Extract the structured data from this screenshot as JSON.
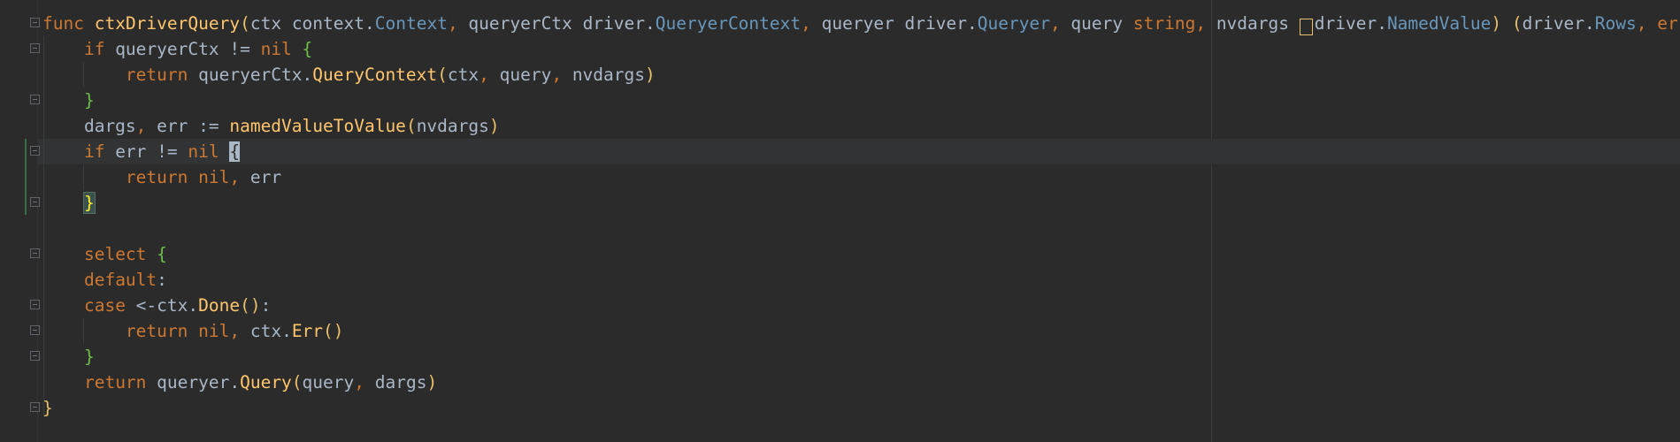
{
  "editor": {
    "theme_colors": {
      "background": "#2b2b2b",
      "keyword": "#cc7832",
      "function": "#ffc66d",
      "type": "#6897bb",
      "identifier": "#a9b7c6"
    },
    "lines": [
      {
        "tokens": [
          {
            "t": "func",
            "c": "kw"
          },
          {
            "t": " ",
            "c": "id"
          },
          {
            "t": "ctxDriverQuery",
            "c": "fn"
          },
          {
            "t": "(",
            "c": "br"
          },
          {
            "t": "ctx ",
            "c": "id"
          },
          {
            "t": "context",
            "c": "pkg"
          },
          {
            "t": ".",
            "c": "id"
          },
          {
            "t": "Context",
            "c": "typ"
          },
          {
            "t": ", ",
            "c": "pun"
          },
          {
            "t": "queryerCtx ",
            "c": "id"
          },
          {
            "t": "driver",
            "c": "pkg"
          },
          {
            "t": ".",
            "c": "id"
          },
          {
            "t": "QueryerContext",
            "c": "typ"
          },
          {
            "t": ", ",
            "c": "pun"
          },
          {
            "t": "queryer ",
            "c": "id"
          },
          {
            "t": "driver",
            "c": "pkg"
          },
          {
            "t": ".",
            "c": "id"
          },
          {
            "t": "Queryer",
            "c": "typ"
          },
          {
            "t": ", ",
            "c": "pun"
          },
          {
            "t": "query ",
            "c": "id"
          },
          {
            "t": "string",
            "c": "kw"
          },
          {
            "t": ", ",
            "c": "pun"
          },
          {
            "t": "nvdargs ",
            "c": "id"
          },
          {
            "t": "[]",
            "c": "box"
          },
          {
            "t": "driver",
            "c": "pkg"
          },
          {
            "t": ".",
            "c": "id"
          },
          {
            "t": "NamedValue",
            "c": "typ"
          },
          {
            "t": ")",
            "c": "br"
          },
          {
            "t": " ",
            "c": "id"
          },
          {
            "t": "(",
            "c": "br"
          },
          {
            "t": "driver",
            "c": "pkg"
          },
          {
            "t": ".",
            "c": "id"
          },
          {
            "t": "Rows",
            "c": "typ"
          },
          {
            "t": ", ",
            "c": "pun"
          },
          {
            "t": "error",
            "c": "kw"
          },
          {
            "t": ")",
            "c": "br"
          },
          {
            "t": " ",
            "c": "id"
          },
          {
            "t": "{",
            "c": "br"
          }
        ]
      },
      {
        "tokens": [
          {
            "t": "    ",
            "c": "id"
          },
          {
            "t": "if",
            "c": "kw"
          },
          {
            "t": " queryerCtx != ",
            "c": "id"
          },
          {
            "t": "nil",
            "c": "kw"
          },
          {
            "t": " ",
            "c": "id"
          },
          {
            "t": "{",
            "c": "br2"
          }
        ]
      },
      {
        "tokens": [
          {
            "t": "        ",
            "c": "id"
          },
          {
            "t": "return",
            "c": "kw"
          },
          {
            "t": " queryerCtx.",
            "c": "id"
          },
          {
            "t": "QueryContext",
            "c": "fn"
          },
          {
            "t": "(",
            "c": "br"
          },
          {
            "t": "ctx",
            "c": "id"
          },
          {
            "t": ", ",
            "c": "pun"
          },
          {
            "t": "query",
            "c": "id"
          },
          {
            "t": ", ",
            "c": "pun"
          },
          {
            "t": "nvdargs",
            "c": "id"
          },
          {
            "t": ")",
            "c": "br"
          }
        ]
      },
      {
        "tokens": [
          {
            "t": "    ",
            "c": "id"
          },
          {
            "t": "}",
            "c": "br2"
          }
        ]
      },
      {
        "tokens": [
          {
            "t": "    dargs",
            "c": "id"
          },
          {
            "t": ", ",
            "c": "pun"
          },
          {
            "t": "err := ",
            "c": "id"
          },
          {
            "t": "namedValueToValue",
            "c": "fn"
          },
          {
            "t": "(",
            "c": "br"
          },
          {
            "t": "nvdargs",
            "c": "id"
          },
          {
            "t": ")",
            "c": "br"
          }
        ]
      },
      {
        "tokens": [
          {
            "t": "    ",
            "c": "id"
          },
          {
            "t": "if",
            "c": "kw"
          },
          {
            "t": " err != ",
            "c": "id"
          },
          {
            "t": "nil",
            "c": "kw"
          },
          {
            "t": " ",
            "c": "id"
          },
          {
            "t": "{",
            "c": "caret"
          }
        ]
      },
      {
        "tokens": [
          {
            "t": "        ",
            "c": "id"
          },
          {
            "t": "return",
            "c": "kw"
          },
          {
            "t": " ",
            "c": "id"
          },
          {
            "t": "nil",
            "c": "kw"
          },
          {
            "t": ", ",
            "c": "pun"
          },
          {
            "t": "err",
            "c": "id"
          }
        ]
      },
      {
        "tokens": [
          {
            "t": "    ",
            "c": "id"
          },
          {
            "t": "}",
            "c": "match"
          }
        ]
      },
      {
        "tokens": [
          {
            "t": "",
            "c": "id"
          }
        ]
      },
      {
        "tokens": [
          {
            "t": "    ",
            "c": "id"
          },
          {
            "t": "select",
            "c": "kw"
          },
          {
            "t": " ",
            "c": "id"
          },
          {
            "t": "{",
            "c": "br2"
          }
        ]
      },
      {
        "tokens": [
          {
            "t": "    ",
            "c": "id"
          },
          {
            "t": "default",
            "c": "kw"
          },
          {
            "t": ":",
            "c": "id"
          }
        ]
      },
      {
        "tokens": [
          {
            "t": "    ",
            "c": "id"
          },
          {
            "t": "case",
            "c": "kw"
          },
          {
            "t": " <-ctx.",
            "c": "id"
          },
          {
            "t": "Done",
            "c": "fn"
          },
          {
            "t": "()",
            "c": "br"
          },
          {
            "t": ":",
            "c": "id"
          }
        ]
      },
      {
        "tokens": [
          {
            "t": "        ",
            "c": "id"
          },
          {
            "t": "return",
            "c": "kw"
          },
          {
            "t": " ",
            "c": "id"
          },
          {
            "t": "nil",
            "c": "kw"
          },
          {
            "t": ", ",
            "c": "pun"
          },
          {
            "t": "ctx.",
            "c": "id"
          },
          {
            "t": "Err",
            "c": "fn"
          },
          {
            "t": "()",
            "c": "br"
          }
        ]
      },
      {
        "tokens": [
          {
            "t": "    ",
            "c": "id"
          },
          {
            "t": "}",
            "c": "br2"
          }
        ]
      },
      {
        "tokens": [
          {
            "t": "    ",
            "c": "id"
          },
          {
            "t": "return",
            "c": "kw"
          },
          {
            "t": " queryer.",
            "c": "id"
          },
          {
            "t": "Query",
            "c": "fn"
          },
          {
            "t": "(",
            "c": "br"
          },
          {
            "t": "query",
            "c": "id"
          },
          {
            "t": ", ",
            "c": "pun"
          },
          {
            "t": "dargs",
            "c": "id"
          },
          {
            "t": ")",
            "c": "br"
          }
        ]
      },
      {
        "tokens": [
          {
            "t": "}",
            "c": "br"
          }
        ]
      }
    ]
  }
}
